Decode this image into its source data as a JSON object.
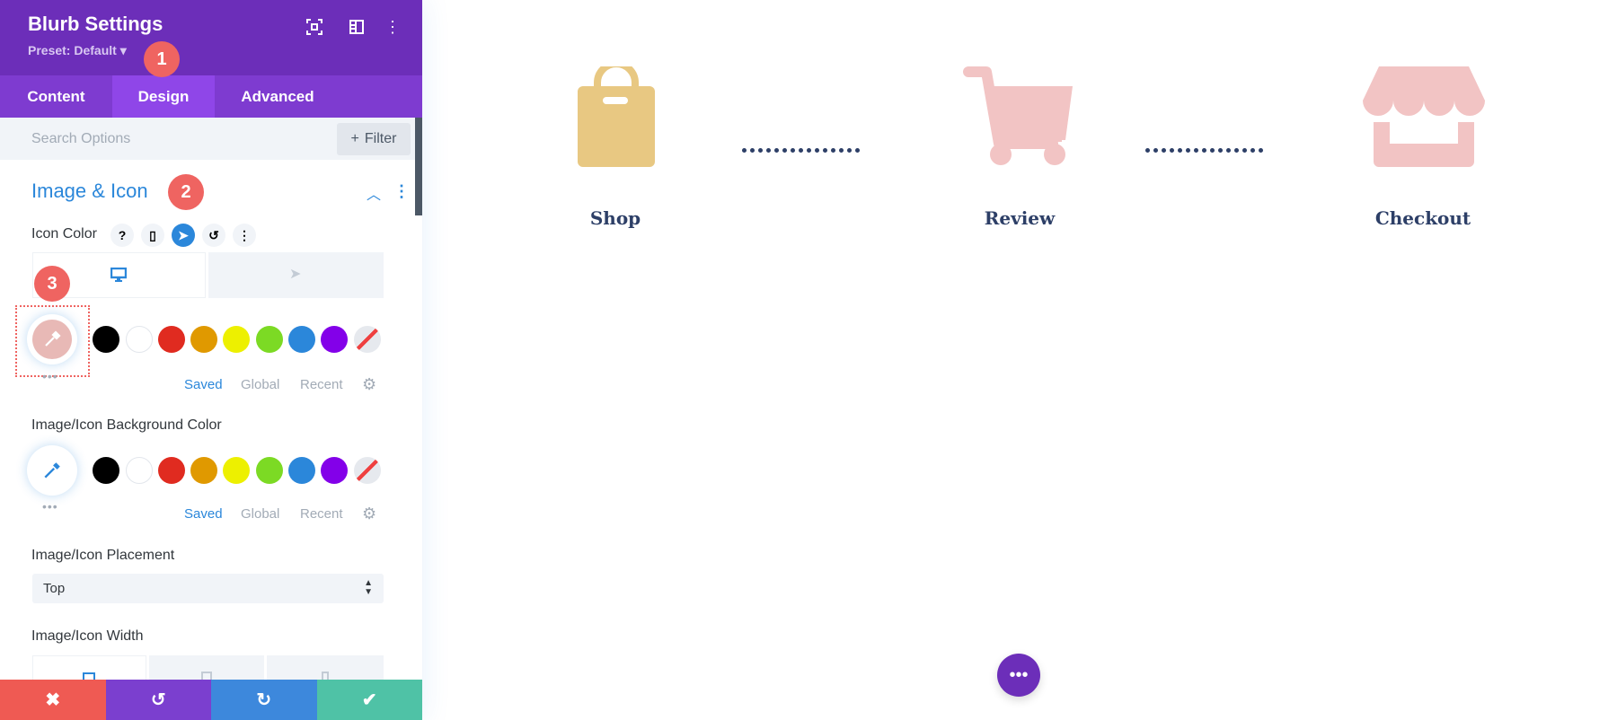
{
  "panel": {
    "title": "Blurb Settings",
    "preset": "Preset: Default ▾",
    "tabs": [
      {
        "label": "Content"
      },
      {
        "label": "Design",
        "active": true
      },
      {
        "label": "Advanced"
      }
    ],
    "search_placeholder": "Search Options",
    "filter_label": "Filter",
    "section_title": "Image & Icon",
    "badges": [
      "1",
      "2",
      "3"
    ],
    "icon_color": {
      "label": "Icon Color",
      "current": "#f0c4c4"
    },
    "bg_color": {
      "label": "Image/Icon Background Color"
    },
    "swatches": [
      "#000000",
      "#ffffff",
      "#e02b20",
      "#e09900",
      "#edf000",
      "#7cda24",
      "#2b87da",
      "#8300e9",
      "none"
    ],
    "palette_tabs": [
      "Saved",
      "Global",
      "Recent"
    ],
    "placement": {
      "label": "Image/Icon Placement",
      "value": "Top"
    },
    "width": {
      "label": "Image/Icon Width"
    }
  },
  "steps": [
    {
      "label": "Shop",
      "color": "#e8c882"
    },
    {
      "label": "Review",
      "color": "#f2c4c4"
    },
    {
      "label": "Checkout",
      "color": "#f2c4c4"
    }
  ],
  "colors": {
    "header": "#6c2eb9",
    "tabs": "#7e3bd0",
    "accent": "#2b87da",
    "cancel": "#ef5a53",
    "undo": "#7b3fcf",
    "redo": "#3d88dc",
    "save": "#4fc2a6"
  }
}
